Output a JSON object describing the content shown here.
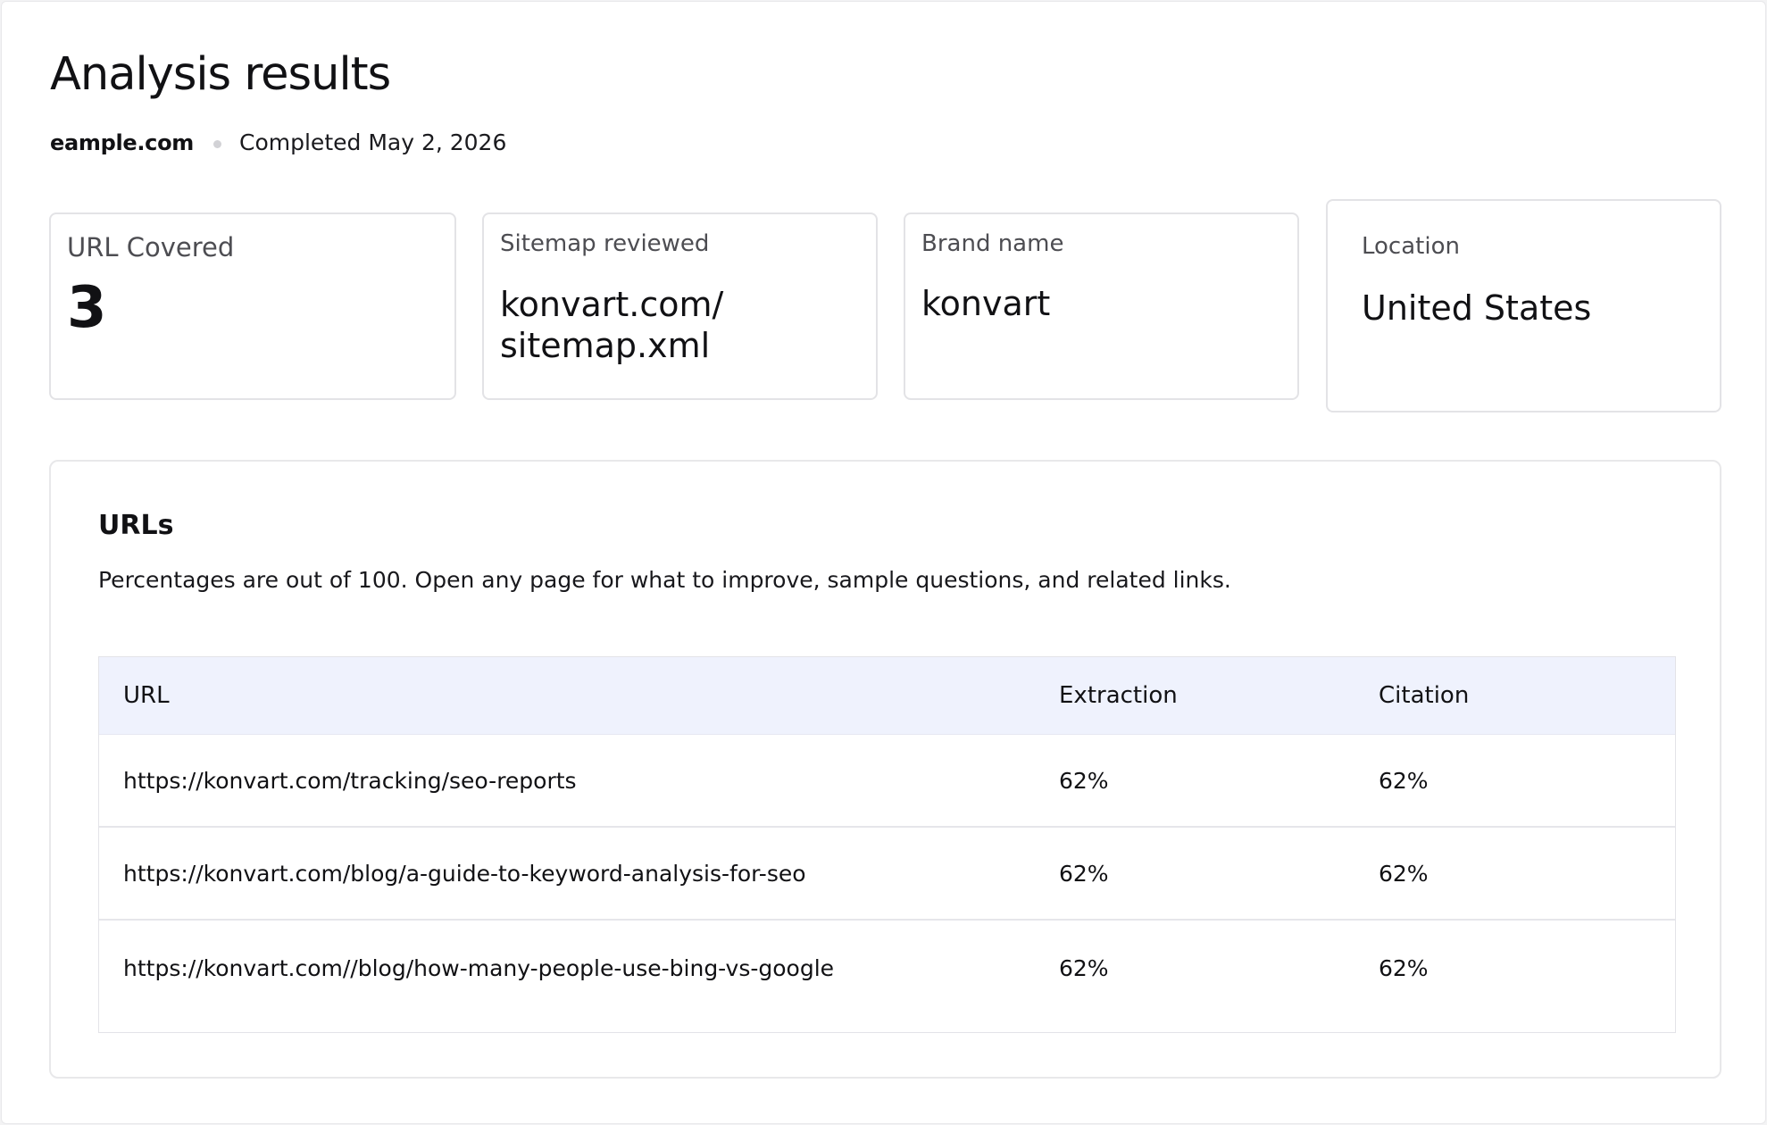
{
  "header": {
    "title": "Analysis results",
    "domain": "eample.com",
    "completed": "Completed May 2, 2026"
  },
  "cards": {
    "url_covered": {
      "label": "URL Covered",
      "value": "3"
    },
    "sitemap": {
      "label": "Sitemap reviewed",
      "value": "konvart.com/\nsitemap.xml"
    },
    "brand": {
      "label": "Brand name",
      "value": "konvart"
    },
    "location": {
      "label": "Location",
      "value": "United States"
    }
  },
  "urls": {
    "title": "URLs",
    "description": "Percentages are out of 100. Open any page for what to improve, sample questions, and related links.",
    "columns": {
      "url": "URL",
      "extraction": "Extraction",
      "citation": "Citation"
    },
    "rows": [
      {
        "url": "https://konvart.com/tracking/seo-reports",
        "extraction": "62%",
        "citation": "62%"
      },
      {
        "url": "https://konvart.com/blog/a-guide-to-keyword-analysis-for-seo",
        "extraction": "62%",
        "citation": "62%"
      },
      {
        "url": "https://konvart.com//blog/how-many-people-use-bing-vs-google",
        "extraction": "62%",
        "citation": "62%"
      }
    ]
  }
}
